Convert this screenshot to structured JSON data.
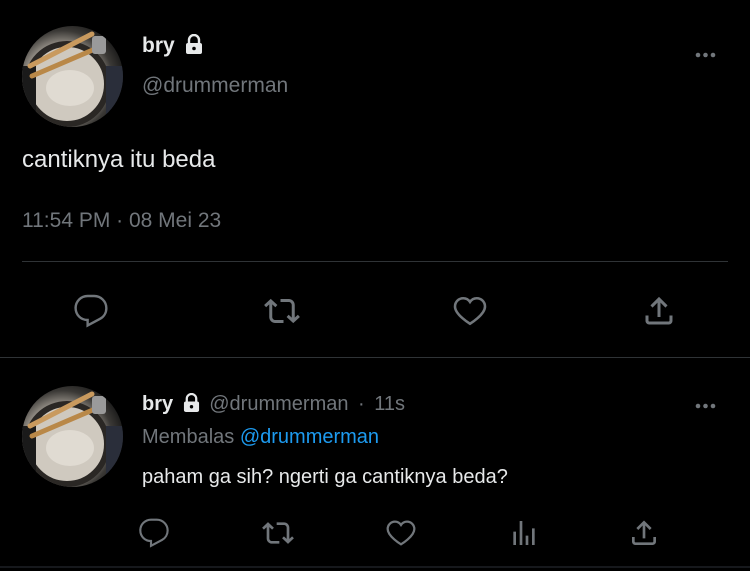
{
  "main_tweet": {
    "display_name": "bry",
    "handle": "@drummerman",
    "text": "cantiknya itu beda",
    "timestamp": "11:54 PM · 08 Mei 23"
  },
  "reply_tweet": {
    "display_name": "bry",
    "handle": "@drummerman",
    "time_ago": "11s",
    "replying_to_label": "Membalas",
    "replying_to_handle": "@drummerman",
    "text": "paham ga sih? ngerti ga cantiknya beda?"
  },
  "colors": {
    "background": "#000000",
    "text_primary": "#e7e9ea",
    "text_secondary": "#71767b",
    "accent": "#1d9bf0",
    "divider": "#2f3336"
  },
  "icons": {
    "main_actions": [
      "reply-icon",
      "retweet-icon",
      "like-icon",
      "share-icon"
    ],
    "reply_actions": [
      "reply-icon",
      "retweet-icon",
      "like-icon",
      "views-icon",
      "share-icon"
    ],
    "lock": "lock-icon",
    "more": "more-icon"
  }
}
